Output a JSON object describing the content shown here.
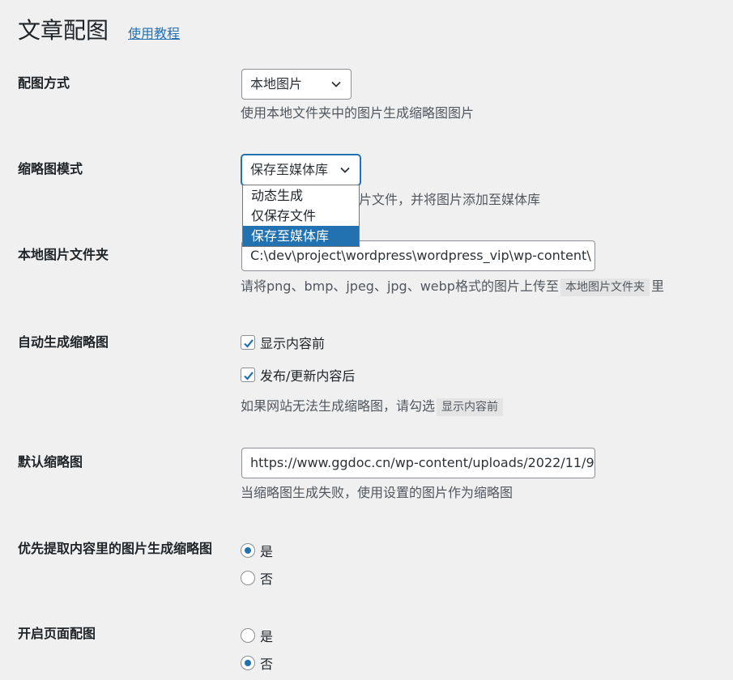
{
  "header": {
    "title": "文章配图",
    "tutorial_link": "使用教程"
  },
  "rows": {
    "image_source": {
      "label": "配图方式",
      "select_value": "本地图片",
      "description": "使用本地文件夹中的图片生成缩略图图片"
    },
    "thumbnail_mode": {
      "label": "缩略图模式",
      "select_value": "保存至媒体库",
      "description_visible": "片文件，并将图片添加至媒体库",
      "options": [
        "动态生成",
        "仅保存文件",
        "保存至媒体库"
      ]
    },
    "local_folder": {
      "label": "本地图片文件夹",
      "value": "C:\\dev\\project\\wordpress\\wordpress_vip\\wp-content\\",
      "desc_before": "请将png、bmp、jpeg、jpg、webp格式的图片上传至",
      "desc_code": "本地图片文件夹",
      "desc_after": "里"
    },
    "auto_generate": {
      "label": "自动生成缩略图",
      "checkbox1": "显示内容前",
      "checkbox2": "发布/更新内容后",
      "desc_before": "如果网站无法生成缩略图，请勾选",
      "desc_code": "显示内容前"
    },
    "default_thumbnail": {
      "label": "默认缩略图",
      "value": "https://www.ggdoc.cn/wp-content/uploads/2022/11/9",
      "description": "当缩略图生成失败，使用设置的图片作为缩略图"
    },
    "prefer_content_image": {
      "label": "优先提取内容里的图片生成缩略图",
      "yes": "是",
      "no": "否",
      "selected": "是"
    },
    "page_image": {
      "label": "开启页面配图",
      "yes": "是",
      "no": "否",
      "selected": "否"
    }
  },
  "colors": {
    "accent": "#2271b1",
    "background": "#f0f0f1"
  }
}
